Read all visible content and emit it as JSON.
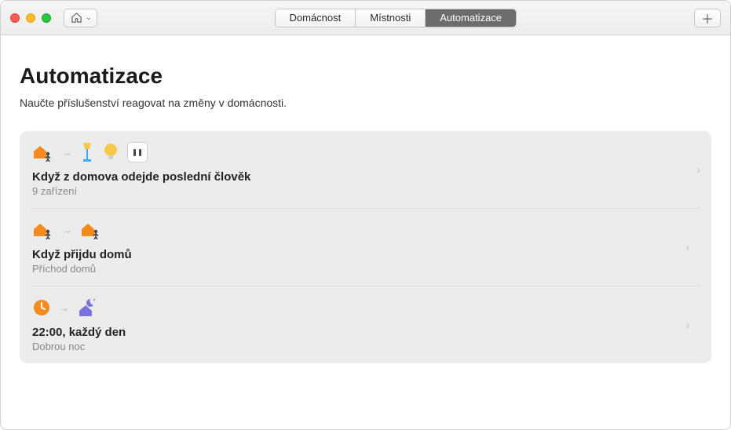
{
  "tabs": {
    "home": "Domácnost",
    "rooms": "Místnosti",
    "automation": "Automatizace"
  },
  "page": {
    "title": "Automatizace",
    "subtitle": "Naučte příslušenství reagovat na změny v domácnosti."
  },
  "automations": [
    {
      "title": "Když z domova odejde poslední člověk",
      "subtitle": "9 zařízení"
    },
    {
      "title": "Když přijdu domů",
      "subtitle": "Příchod domů"
    },
    {
      "title": "22:00, každý den",
      "subtitle": "Dobrou noc"
    }
  ],
  "colors": {
    "orange": "#f58b1f",
    "blue": "#3fa9f5",
    "yellow": "#f7c948",
    "purple": "#7a73d9"
  }
}
